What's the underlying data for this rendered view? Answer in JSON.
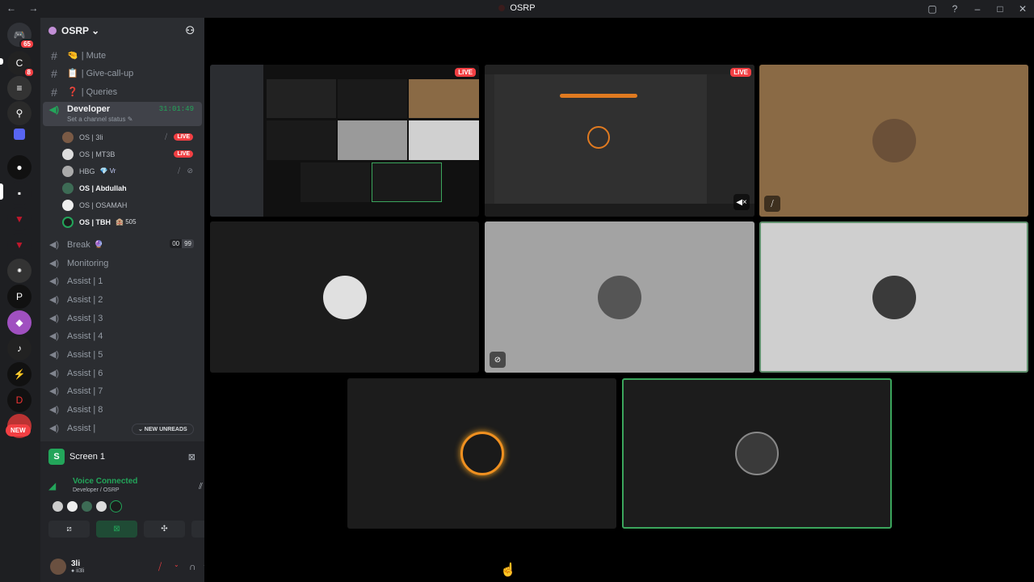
{
  "window": {
    "title": "OSRP",
    "nav": "← →"
  },
  "guilds": {
    "home_badge": "65",
    "second_badge": "8",
    "new_label": "NEW"
  },
  "server": {
    "name": "OSRP ⌄"
  },
  "channels": {
    "mute": "| Mute",
    "give": "| Give-call-up",
    "queries": "| Queries",
    "developer": {
      "name": "Developer",
      "timer": "31:01:49",
      "status": "Set a channel status ✎"
    },
    "users": [
      {
        "name": "OS | 3li",
        "live": "LIVE"
      },
      {
        "name": "OS | MT3B",
        "live": "LIVE"
      },
      {
        "name": "HBG",
        "tag": "💎 Vr"
      },
      {
        "name": "OS | Abdullah"
      },
      {
        "name": "OS | OSAMAH"
      },
      {
        "name": "OS | TBH",
        "tag": "🏨 505"
      }
    ],
    "break": {
      "name": "Break",
      "count_a": "00",
      "count_b": "99"
    },
    "voice": [
      "Monitoring",
      "Assist | 1",
      "Assist | 2",
      "Assist | 3",
      "Assist | 4",
      "Assist | 5",
      "Assist | 6",
      "Assist | 7",
      "Assist | 8",
      "Assist |"
    ],
    "unreads": "⌄ NEW UNREADS"
  },
  "panel": {
    "screen_label": "Screen 1",
    "screen_letter": "S",
    "voice_connected": "Voice Connected",
    "voice_sub": "Developer / OSRP",
    "username": "3li",
    "user_sub": "● ii3li"
  },
  "stage": {
    "live_label": "LIVE"
  },
  "colors": {
    "accent": "#23a55a",
    "live": "#f23f43",
    "sidebar": "#2b2d31",
    "rail": "#1e1f22"
  }
}
